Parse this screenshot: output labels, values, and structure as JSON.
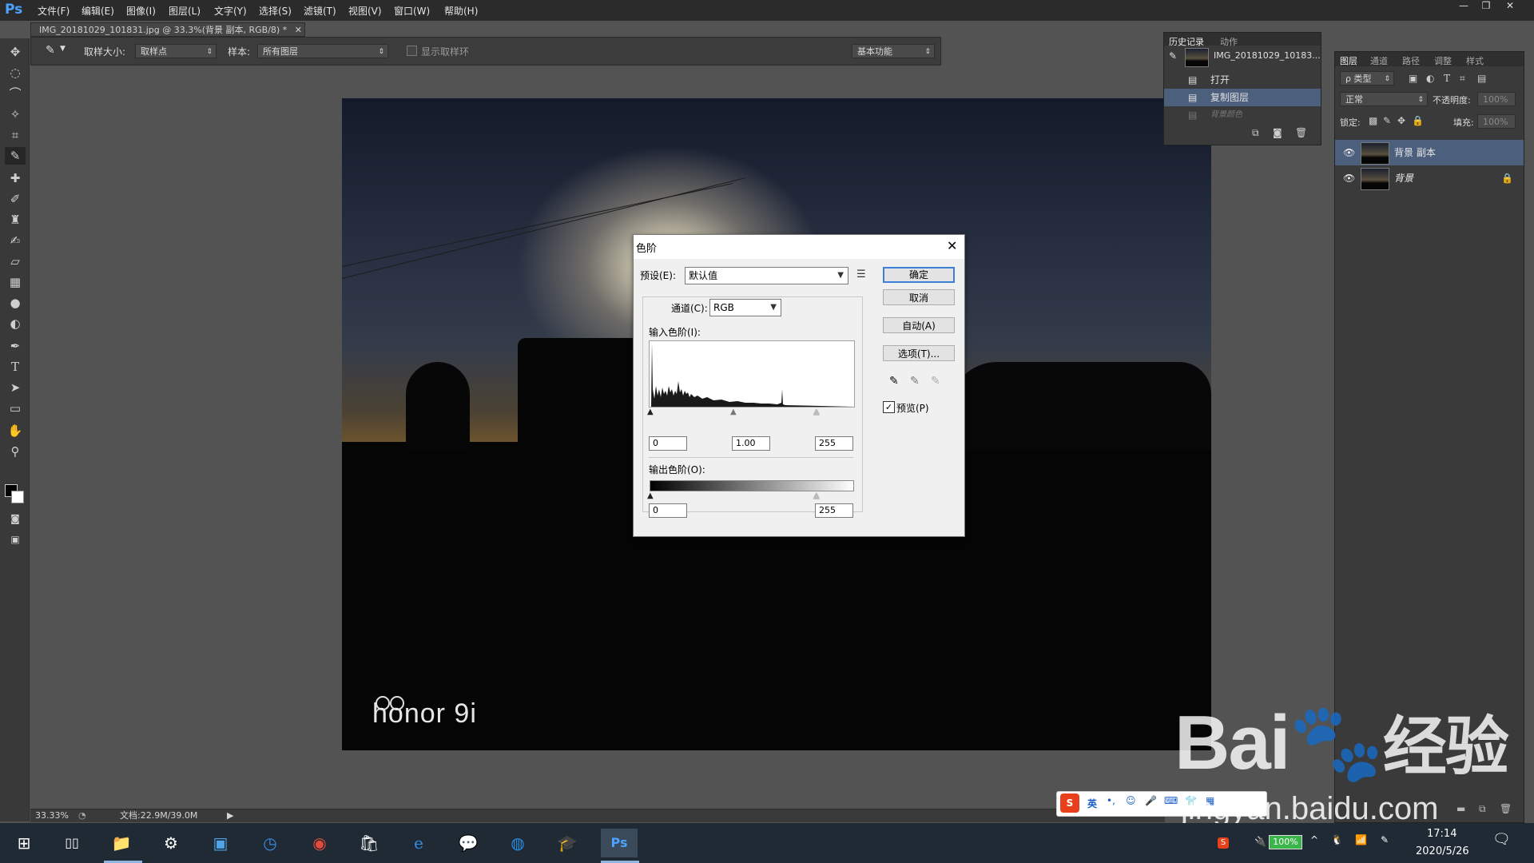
{
  "app": {
    "logo": "Ps",
    "menus": [
      "文件(F)",
      "编辑(E)",
      "图像(I)",
      "图层(L)",
      "文字(Y)",
      "选择(S)",
      "滤镜(T)",
      "视图(V)",
      "窗口(W)",
      "帮助(H)"
    ]
  },
  "document": {
    "tab_title": "IMG_20181029_101831.jpg @ 33.3%(背景 副本, RGB/8) *",
    "zoom": "33.33%",
    "doc_size": "文档:22.9M/39.0M",
    "watermark_brand": "honor 9i"
  },
  "options_bar": {
    "sample_size_label": "取样大小:",
    "sample_size_value": "取样点",
    "sample_label": "样本:",
    "sample_value": "所有图层",
    "show_ring_label": "显示取样环",
    "workspace": "基本功能"
  },
  "history_panel": {
    "tabs": [
      "历史记录",
      "动作"
    ],
    "snapshot": "IMG_20181029_10183...",
    "items": [
      "打开",
      "复制图层",
      "背景颜色"
    ]
  },
  "layers_panel": {
    "tabs": [
      "图层",
      "通道",
      "路径",
      "调整",
      "样式"
    ],
    "filter_label": "ρ 类型",
    "blend_mode": "正常",
    "opacity_label": "不透明度:",
    "opacity_value": "100%",
    "lock_label": "锁定:",
    "fill_label": "填充:",
    "fill_value": "100%",
    "layers": [
      "背景 副本",
      "背景"
    ]
  },
  "levels_dialog": {
    "title": "色阶",
    "preset_label": "预设(E):",
    "preset_value": "默认值",
    "channel_label": "通道(C):",
    "channel_value": "RGB",
    "input_levels_label": "输入色阶(I):",
    "input_black": "0",
    "input_gamma": "1.00",
    "input_white": "255",
    "output_levels_label": "输出色阶(O):",
    "output_black": "0",
    "output_white": "255",
    "buttons": {
      "ok": "确定",
      "cancel": "取消",
      "auto": "自动(A)",
      "options": "选项(T)..."
    },
    "preview_label": "预览(P)",
    "preview_checked": true
  },
  "ime_bar": {
    "mode": "英"
  },
  "watermark": {
    "brand": "Bai",
    "brand_suffix": "经验",
    "url": "jingyan.baidu.com"
  },
  "taskbar": {
    "battery": "100%",
    "time": "17:14",
    "date": "2020/5/26"
  }
}
